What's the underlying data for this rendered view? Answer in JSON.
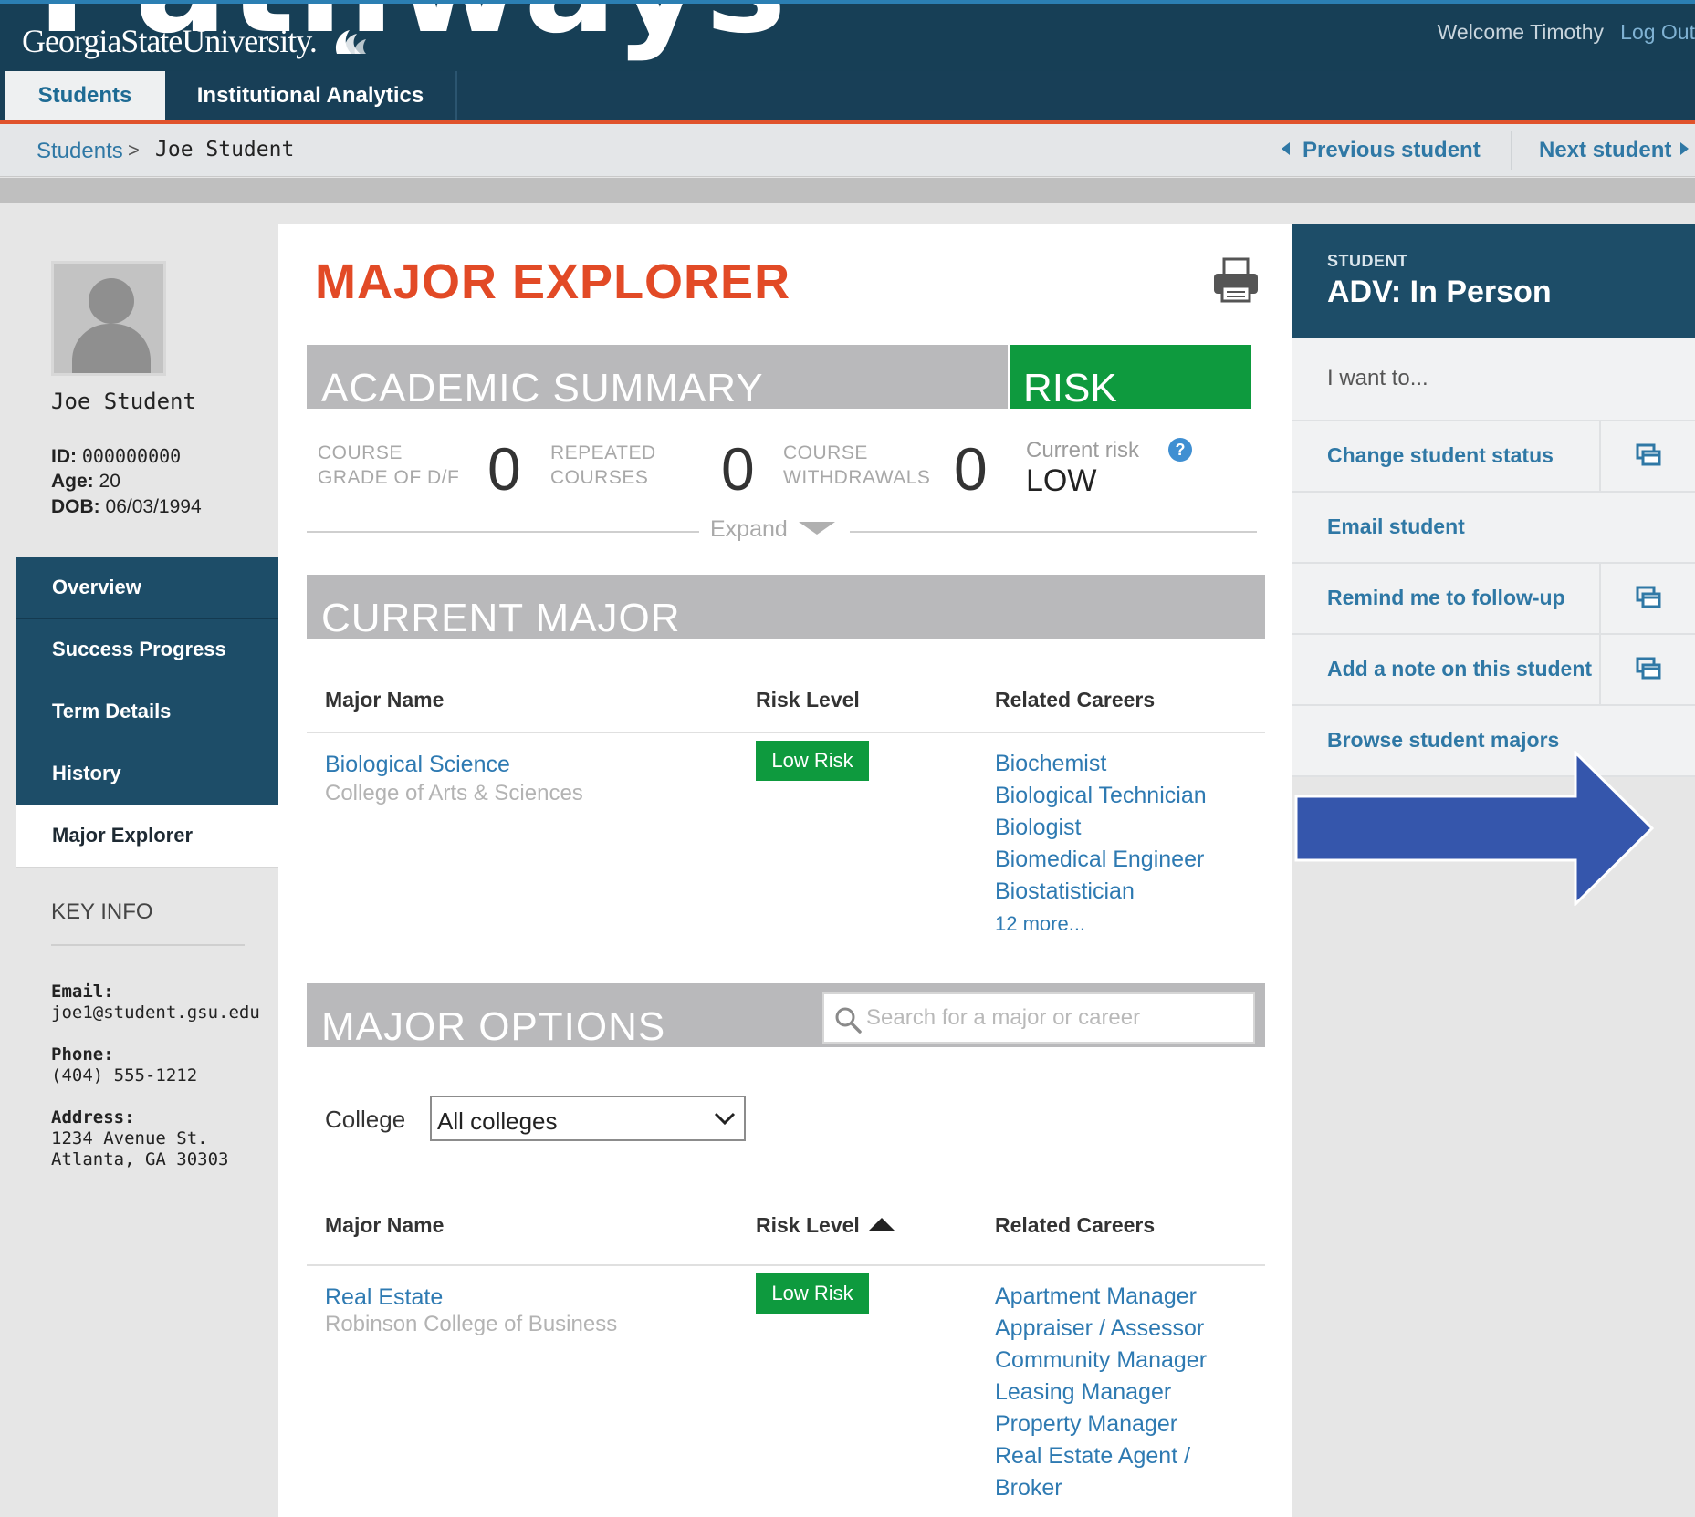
{
  "header": {
    "pathways_text": "Pathways",
    "logo_text": "GeorgiaStateUniversity.",
    "welcome": "Welcome Timothy",
    "logout": "Log Out"
  },
  "tabs": [
    {
      "label": "Students",
      "active": true
    },
    {
      "label": "Institutional Analytics",
      "active": false
    }
  ],
  "breadcrumb": {
    "root": "Students",
    "separator": ">",
    "current": "Joe Student",
    "previous": "Previous student",
    "next": "Next student"
  },
  "student": {
    "name": "Joe Student",
    "id_label": "ID:",
    "id": "000000000",
    "age_label": "Age:",
    "age": "20",
    "dob_label": "DOB:",
    "dob": "06/03/1994"
  },
  "left_nav": [
    {
      "label": "Overview",
      "active": false
    },
    {
      "label": "Success Progress",
      "active": false
    },
    {
      "label": "Term Details",
      "active": false
    },
    {
      "label": "History",
      "active": false
    },
    {
      "label": "Major Explorer",
      "active": true
    }
  ],
  "key_info": {
    "title": "KEY INFO",
    "email_label": "Email:",
    "email": "joe1@student.gsu.edu",
    "phone_label": "Phone:",
    "phone": "(404) 555-1212",
    "address_label": "Address:",
    "address_line1": "1234 Avenue St.",
    "address_line2": "Atlanta, GA 30303"
  },
  "main": {
    "title": "MAJOR EXPLORER",
    "academic_summary": {
      "title": "ACADEMIC SUMMARY",
      "risk_title": "RISK",
      "course_grade_label_1": "COURSE",
      "course_grade_label_2": "GRADE OF D/F",
      "course_grade_value": "0",
      "repeated_label_1": "REPEATED",
      "repeated_label_2": "COURSES",
      "repeated_value": "0",
      "withdrawals_label_1": "COURSE",
      "withdrawals_label_2": "WITHDRAWALS",
      "withdrawals_value": "0",
      "current_risk_label": "Current risk",
      "current_risk_value": "LOW",
      "help_glyph": "?",
      "expand_label": "Expand"
    },
    "current_major": {
      "title": "CURRENT MAJOR",
      "col_major": "Major Name",
      "col_risk": "Risk Level",
      "col_careers": "Related Careers",
      "major": "Biological Science",
      "college": "College of Arts & Sciences",
      "risk": "Low Risk",
      "careers": [
        "Biochemist",
        "Biological Technician",
        "Biologist",
        "Biomedical Engineer",
        "Biostatistician"
      ],
      "more": "12 more..."
    },
    "major_options": {
      "title": "MAJOR OPTIONS",
      "search_placeholder": "Search for a major or career",
      "college_label": "College",
      "college_selected": "All colleges",
      "col_major": "Major Name",
      "col_risk": "Risk Level",
      "col_careers": "Related Careers",
      "major": "Real Estate",
      "college": "Robinson College of Business",
      "risk": "Low Risk",
      "careers": [
        "Apartment Manager",
        "Appraiser / Assessor",
        "Community Manager",
        "Leasing Manager",
        "Property Manager",
        "Real Estate Agent /",
        "Broker"
      ]
    }
  },
  "right_panel": {
    "small": "STUDENT",
    "big": "ADV: In Person",
    "want": "I want to...",
    "actions": [
      {
        "label": "Change student status",
        "has_icon": true
      },
      {
        "label": "Email student",
        "has_icon": false
      },
      {
        "label": "Remind me to follow-up",
        "has_icon": true
      },
      {
        "label": "Add a note on this student",
        "has_icon": true
      },
      {
        "label": "Browse student majors",
        "has_icon": false
      }
    ]
  },
  "colors": {
    "header_navy": "#173f56",
    "accent_orange": "#e24a26",
    "risk_green": "#0e9a3e",
    "link_blue": "#2e7ab2",
    "arrow_blue": "#3556ac"
  },
  "icons": [
    "university-logo-icon",
    "print-icon",
    "help-icon",
    "chevron-down-icon",
    "search-icon",
    "sort-ascending-icon",
    "popup-window-icon",
    "arrow-right-icon"
  ]
}
